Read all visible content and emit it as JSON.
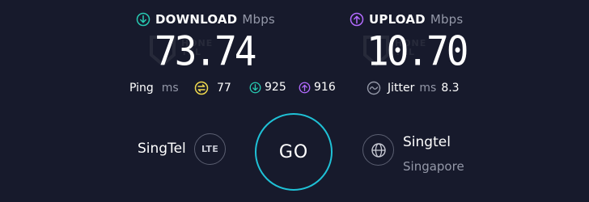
{
  "download": {
    "label": "DOWNLOAD",
    "unit": "Mbps",
    "value": "73.74",
    "color": "#27c9b1",
    "icon": "arrow-down-circle-icon"
  },
  "upload": {
    "label": "UPLOAD",
    "unit": "Mbps",
    "value": "10.70",
    "color": "#b36bff",
    "icon": "arrow-up-circle-icon"
  },
  "ping": {
    "label": "Ping",
    "unit": "ms",
    "idle_value": "77",
    "idle_color": "#f0d94e",
    "download_value": "925",
    "download_color": "#27c9b1",
    "upload_value": "916",
    "upload_color": "#b36bff"
  },
  "jitter": {
    "label": "Jitter",
    "unit": "ms",
    "value": "8.3"
  },
  "isp": {
    "name": "SingTel",
    "connection_type": "LTE"
  },
  "go_button": {
    "label": "GO",
    "color": "#1fc1d6"
  },
  "server": {
    "name": "Singtel",
    "location": "Singapore"
  }
}
